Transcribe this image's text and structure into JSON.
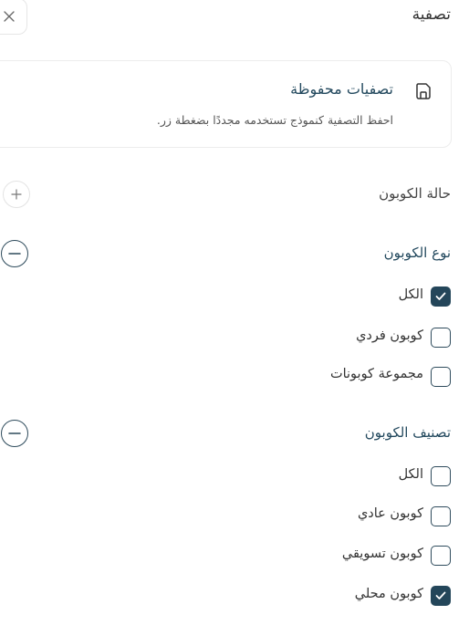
{
  "header": {
    "title": "تصفية"
  },
  "saved_filters": {
    "title": "تصفيات محفوظة",
    "description": "احفظ التصفية كنموذج تستخدمه مجددًا بضغطة زر."
  },
  "coupon_status": {
    "label": "حالة الكوبون",
    "expanded": false
  },
  "coupon_type": {
    "label": "نوع الكوبون",
    "expanded": true,
    "options": [
      {
        "label": "الكل",
        "checked": true
      },
      {
        "label": "كوبون فردي",
        "checked": false
      },
      {
        "label": "مجموعة كوبونات",
        "checked": false
      }
    ]
  },
  "coupon_category": {
    "label": "تصنيف الكوبون",
    "expanded": true,
    "options": [
      {
        "label": "الكل",
        "checked": false
      },
      {
        "label": "كوبون عادي",
        "checked": false
      },
      {
        "label": "كوبون تسويقي",
        "checked": false
      },
      {
        "label": "كوبون محلي",
        "checked": true
      }
    ]
  },
  "colors": {
    "accent": "#24465a",
    "border": "#e6e6e6"
  }
}
